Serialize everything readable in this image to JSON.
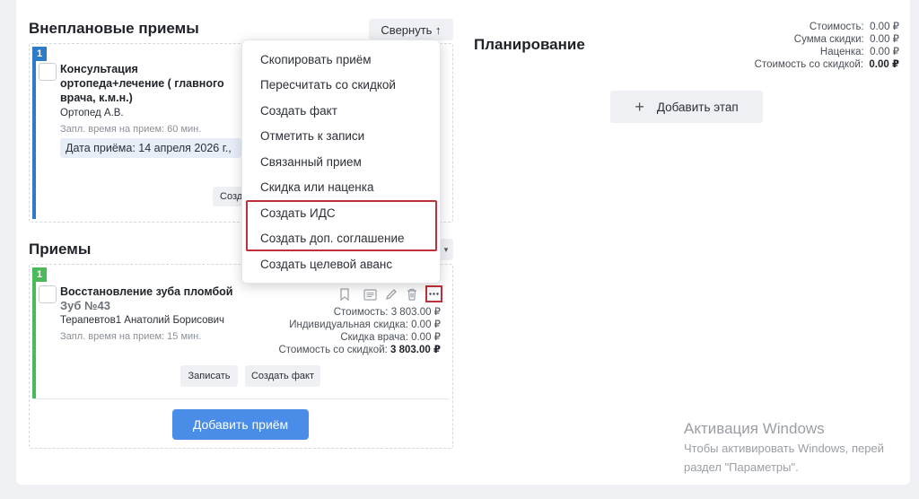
{
  "unplanned": {
    "title": "Внеплановые приемы",
    "collapse_label": "Свернуть ↑",
    "card": {
      "number": "1",
      "title": "Консультация ортопеда+лечение ( главного врача, к.м.н.)",
      "doctor": "Ортопед А.В.",
      "time": "Запл. время на прием: 60 мин.",
      "date": "Дата приёма: 14 апреля 2026 г.,",
      "btn_partial": "Созд"
    }
  },
  "appointments": {
    "title": "Приемы",
    "card": {
      "number": "1",
      "title": "Восстановление зуба пломбой",
      "tooth": "Зуб №43",
      "doctor": "Терапевтов1 Анатолий Борисович",
      "time": "Запл. время на прием: 15 мин.",
      "stats": [
        {
          "label": "Стоимость:",
          "value": "3 803.00 ₽"
        },
        {
          "label": "Индивидуальная скидка:",
          "value": "0.00 ₽"
        },
        {
          "label": "Скидка врача:",
          "value": "0.00 ₽"
        },
        {
          "label": "Стоимость со скидкой:",
          "value": "3 803.00 ₽"
        }
      ],
      "book_label": "Записать",
      "create_fact_label": "Создать факт"
    },
    "add_label": "Добавить приём"
  },
  "planning": {
    "title": "Планирование",
    "add_stage_label": "Добавить этап",
    "summary": [
      {
        "label": "Стоимость:",
        "value": "0.00 ₽"
      },
      {
        "label": "Сумма скидки:",
        "value": "0.00 ₽"
      },
      {
        "label": "Наценка:",
        "value": "0.00 ₽"
      },
      {
        "label": "Стоимость со скидкой:",
        "value": "0.00 ₽"
      }
    ]
  },
  "menu": {
    "items": [
      "Скопировать приём",
      "Пересчитать со скидкой",
      "Создать факт",
      "Отметить к записи",
      "Связанный прием",
      "Скидка или наценка",
      "Создать ИДС",
      "Создать доп. соглашение",
      "Создать целевой аванс"
    ]
  },
  "watermark": {
    "title": "Активация Windows",
    "line1": "Чтобы активировать Windows, перей",
    "line2": "раздел \"Параметры\"."
  },
  "colors": {
    "accent_blue": "#4a8de8",
    "unplanned_bar": "#2e7cc8",
    "appointment_bar": "#4cba5a",
    "highlight": "#c0303a"
  }
}
